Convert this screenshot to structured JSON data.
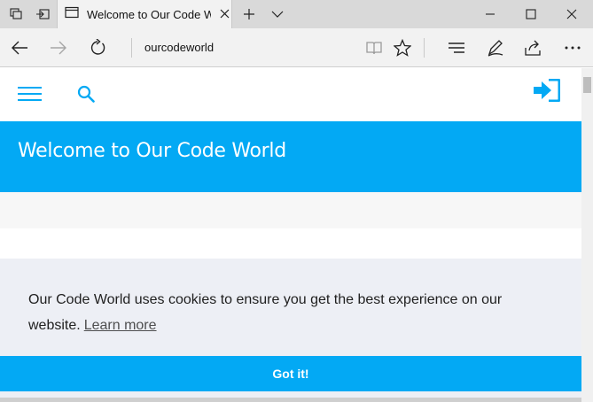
{
  "browser": {
    "tab_title": "Welcome to Our Code World",
    "address": "ourcodeworld"
  },
  "icons": {
    "tab_preview": "tab-preview-icon",
    "set_aside": "set-aside-tabs-icon",
    "page_tab": "page-icon",
    "tab_close": "close-icon",
    "new_tab": "plus-icon",
    "tab_list": "chevron-down-icon",
    "minimize": "minimize-icon",
    "maximize": "maximize-icon",
    "close_window": "close-window-icon",
    "back": "back-arrow-icon",
    "forward": "forward-arrow-icon",
    "refresh": "refresh-icon",
    "reading_view": "book-icon",
    "favorite": "star-icon",
    "hub": "hub-icon",
    "notes": "pen-icon",
    "share": "share-icon",
    "more": "more-icon",
    "site_menu": "hamburger-menu-icon",
    "site_search": "search-icon",
    "site_login": "login-icon"
  },
  "site": {
    "hero_title": "Welcome to Our Code World"
  },
  "cookie": {
    "message": "Our Code World uses cookies to ensure you get the best experience on our website.",
    "link": "Learn more",
    "button": "Got it!"
  },
  "colors": {
    "accent": "#03a9f4",
    "banner_bg": "#edeff5"
  }
}
